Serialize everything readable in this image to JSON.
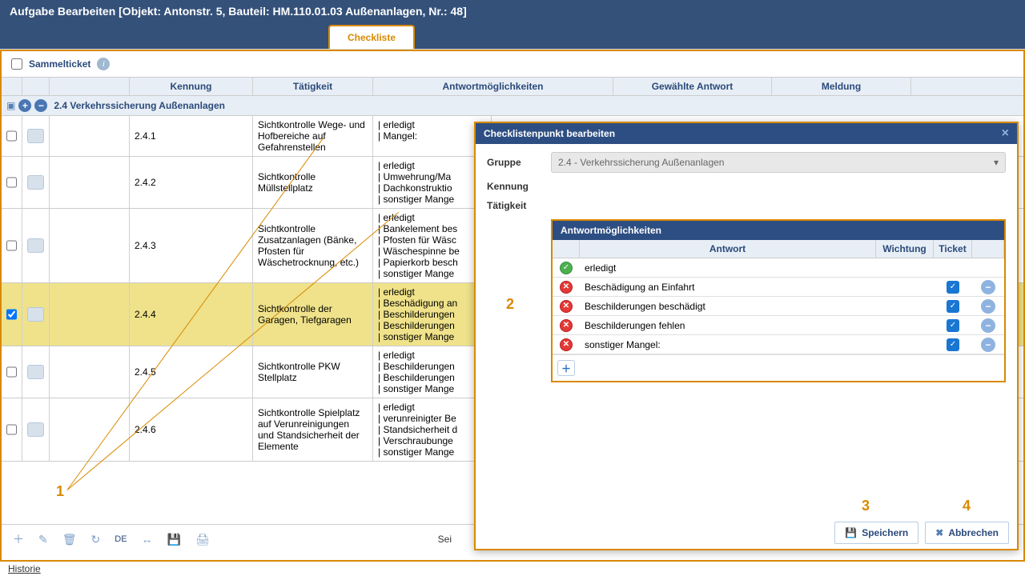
{
  "title": "Aufgabe Bearbeiten [Objekt: Antonstr. 5, Bauteil: HM.110.01.03 Außenanlagen, Nr.: 48]",
  "tab": "Checkliste",
  "sammel": "Sammelticket",
  "cols": {
    "kennung": "Kennung",
    "taet": "Tätigkeit",
    "ant": "Antwortmöglichkeiten",
    "gew": "Gewählte Antwort",
    "mld": "Meldung"
  },
  "group": "2.4 Verkehrssicherung Außenanlagen",
  "rows": [
    {
      "k": "2.4.1",
      "t": "Sichtkontrolle Wege- und Hofbereiche auf Gefahrenstellen",
      "a": [
        "| erledigt",
        "| Mangel:"
      ]
    },
    {
      "k": "2.4.2",
      "t": "Sichtkontrolle Müllstellplatz",
      "a": [
        "| erledigt",
        "| Umwehrung/Ma",
        "| Dachkonstruktio",
        "| sonstiger Mange"
      ]
    },
    {
      "k": "2.4.3",
      "t": "Sichtkontrolle Zusatzanlagen (Bänke, Pfosten für Wäschetrocknung, etc.)",
      "a": [
        "| erledigt",
        "| Bankelement bes",
        "| Pfosten für Wäsc",
        "| Wäschespinne be",
        "| Papierkorb besch",
        "| sonstiger Mange"
      ]
    },
    {
      "k": "2.4.4",
      "t": "Sichtkontrolle der Garagen, Tiefgaragen",
      "a": [
        "| erledigt",
        "| Beschädigung an",
        "| Beschilderungen",
        "| Beschilderungen",
        "| sonstiger Mange"
      ],
      "sel": true,
      "checked": true
    },
    {
      "k": "2.4.5",
      "t": "Sichtkontrolle PKW Stellplatz",
      "a": [
        "| erledigt",
        "| Beschilderungen",
        "| Beschilderungen",
        "| sonstiger Mange"
      ]
    },
    {
      "k": "2.4.6",
      "t": "Sichtkontrolle Spielplatz auf Verunreinigungen und Standsicherheit der Elemente",
      "a": [
        "| erledigt",
        "| verunreinigter Be",
        "| Standsicherheit d",
        "| Verschraubunge",
        "| sonstiger Mange"
      ]
    }
  ],
  "toolbar": {
    "lang": "DE",
    "seite": "Sei"
  },
  "dialog": {
    "title": "Checklistenpunkt bearbeiten",
    "gruppe_lbl": "Gruppe",
    "gruppe_val": "2.4 - Verkehrssicherung Außenanlagen",
    "kennung_lbl": "Kennung",
    "taet_lbl": "Tätigkeit",
    "panel_title": "Antwortmöglichkeiten",
    "head": {
      "ant": "Antwort",
      "wich": "Wichtung",
      "tick": "Ticket"
    },
    "answers": [
      {
        "ok": true,
        "text": "erledigt",
        "ticket": false,
        "rm": false
      },
      {
        "ok": false,
        "text": "Beschädigung an Einfahrt",
        "ticket": true,
        "rm": true
      },
      {
        "ok": false,
        "text": "Beschilderungen beschädigt",
        "ticket": true,
        "rm": true
      },
      {
        "ok": false,
        "text": "Beschilderungen fehlen",
        "ticket": true,
        "rm": true
      },
      {
        "ok": false,
        "text": "sonstiger Mangel:",
        "ticket": true,
        "rm": true
      }
    ],
    "save": "Speichern",
    "cancel": "Abbrechen"
  },
  "historie": "Historie",
  "callouts": {
    "c1": "1",
    "c2": "2",
    "c3": "3",
    "c4": "4"
  }
}
